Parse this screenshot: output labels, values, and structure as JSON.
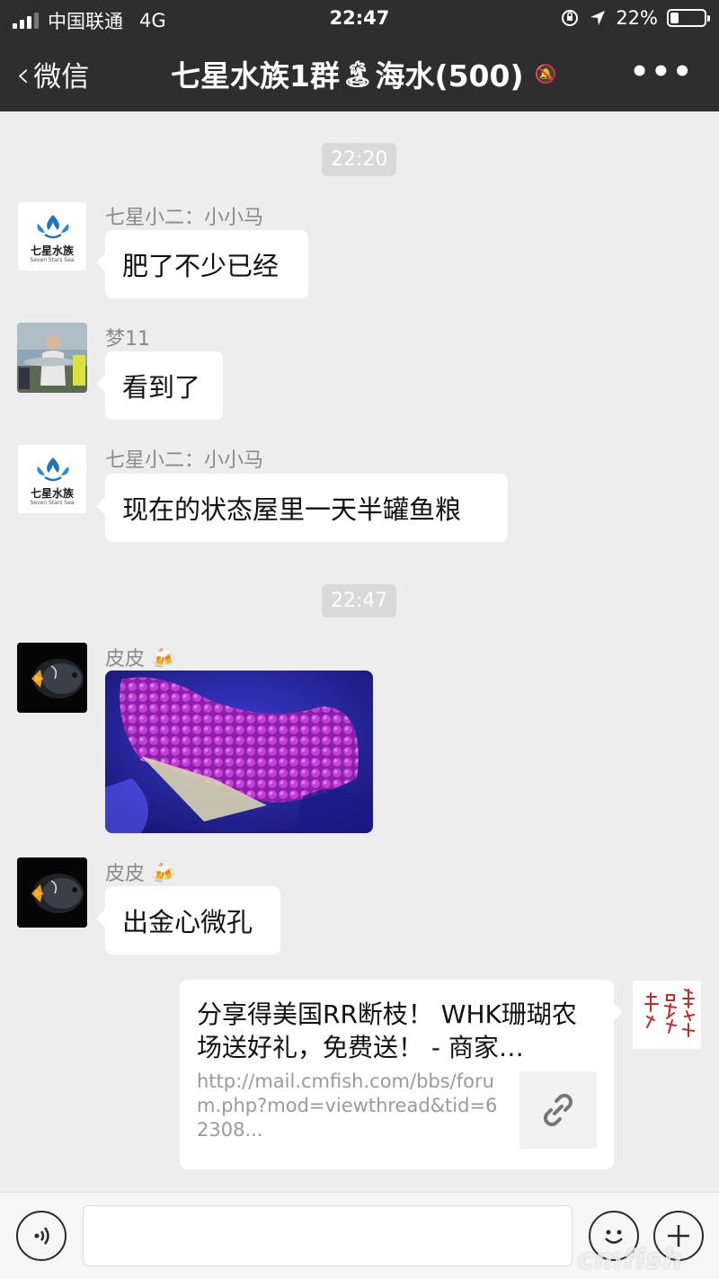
{
  "status_bar": {
    "carrier": "中国联通",
    "network": "4G",
    "time": "22:47",
    "battery": "22%"
  },
  "nav": {
    "back_label": "微信",
    "title_prefix": "七星水族1群",
    "title_emoji": "🏝",
    "title_suffix": "海水(500)"
  },
  "chat": {
    "time_1": "22:20",
    "time_2": "22:47",
    "messages": [
      {
        "sender": "七星小二：小小马",
        "text": "肥了不少已经"
      },
      {
        "sender": "梦11",
        "text": "看到了"
      },
      {
        "sender": "七星小二：小小马",
        "text": "现在的状态屋里一天半罐鱼粮"
      },
      {
        "sender": "皮皮 🍻",
        "text": ""
      },
      {
        "sender": "皮皮 🍻",
        "text": "出金心微孔"
      }
    ],
    "link": {
      "title": "分享得美国RR断枝！ WHK珊瑚农场送好礼，免费送！ - 商家…",
      "url": "http://mail.cmfish.com/bbs/forum.php?mod=viewthread&tid=62308..."
    },
    "logo_text_cn": "七星水族",
    "logo_text_en": "Seven Stars Sea"
  },
  "input": {
    "value": ""
  },
  "watermark": "cmfish"
}
